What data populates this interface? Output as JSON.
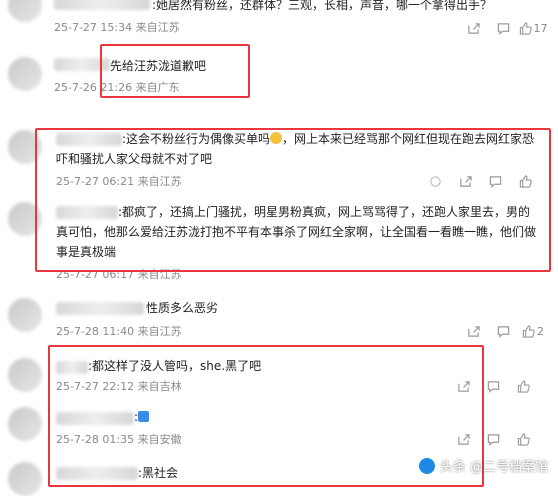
{
  "comments": [
    {
      "text": ":她居然有粉丝，还群体？三观，长相，声音，哪一个拿得出手？",
      "time": "25-7-27 15:34",
      "location": "来自江苏",
      "likes": "17"
    },
    {
      "text": "先给汪苏泷道歉吧",
      "time": "25-7-26",
      "time2": "21:26",
      "location": "来自广东",
      "likes": ""
    },
    {
      "text": ":这会不粉丝行为偶像买单吗",
      "text_b": "，网上本来已经骂那个网红但现在跑去网红家恐吓和骚扰人家父母就不对了吧",
      "time": "25-7-27 06:21",
      "location": "来自江苏",
      "likes": ""
    },
    {
      "text": ":都疯了，还搞上门骚扰，明星男粉真疯，网上骂骂得了，还跑人家里去，男的真可怕，他那么爱给汪苏泷打抱不平有本事杀了网红全家啊，让全国看一看瞧一瞧，他们做事是真极端",
      "time": "25-7-27 06:17",
      "location": "来自江苏",
      "likes": ""
    },
    {
      "text": "性质多么恶劣",
      "time": "25-7-28 11:40",
      "location": "来自江苏",
      "likes": "2"
    },
    {
      "text": ":都这样了没人管吗，she.黑了吧",
      "time": "25-7-27 22:12",
      "location": "来自吉林",
      "likes": ""
    },
    {
      "text": ":",
      "time": "25-7-28 01:35",
      "location": "来自安徽",
      "likes": ""
    },
    {
      "text": ":黑社会",
      "time": "",
      "location": "",
      "likes": ""
    }
  ],
  "watermark": {
    "text": "头条 @二号档案馆"
  },
  "colors": {
    "highlight": "#e8383d",
    "meta": "#8a8a8a"
  }
}
